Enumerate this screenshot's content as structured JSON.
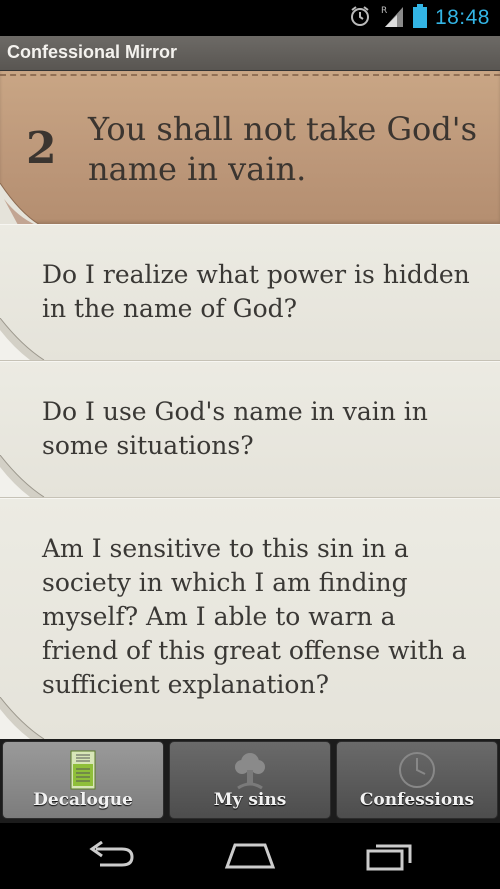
{
  "status_bar": {
    "time": "18:48",
    "icons": [
      "alarm-icon",
      "signal-icon",
      "battery-icon"
    ],
    "signal_label": "R"
  },
  "app": {
    "title": "Confessional Mirror"
  },
  "commandment": {
    "number": "2",
    "text": "You shall not take God's name in vain."
  },
  "questions": [
    {
      "text": "Do I realize what power is hidden in the name of God?"
    },
    {
      "text": "Do I use God's name in vain in some situations?"
    },
    {
      "text": "Am I sensitive to this sin in a society in which I am finding myself? Am I able to warn a friend of this great offense with a sufficient explanation?"
    }
  ],
  "tabs": [
    {
      "label": "Decalogue",
      "icon": "tablet-icon",
      "active": true
    },
    {
      "label": "My sins",
      "icon": "tree-icon",
      "active": false
    },
    {
      "label": "Confessions",
      "icon": "clock-icon",
      "active": false
    }
  ],
  "nav": [
    "back-icon",
    "home-icon",
    "recents-icon"
  ],
  "colors": {
    "accent_time": "#33b5e5",
    "header_card": "#bd987a",
    "question_card": "#e9e7df",
    "text": "#3a3835"
  }
}
